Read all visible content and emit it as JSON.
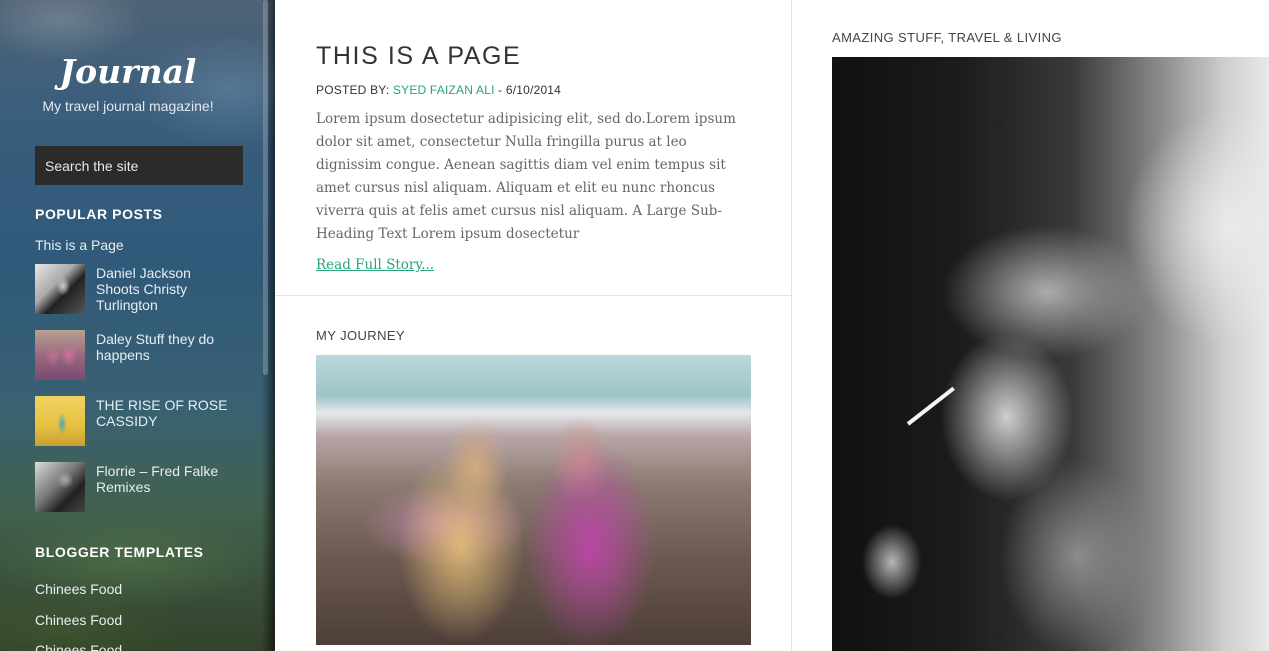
{
  "sidebar": {
    "site_title": "Journal",
    "tagline": "My travel journal magazine!",
    "search_placeholder": "Search the site",
    "popular_heading": "POPULAR POSTS",
    "popular_first_link": "This is a Page",
    "popular_posts": [
      {
        "title": "Daniel Jackson Shoots Christy Turlington"
      },
      {
        "title": "Daley Stuff they do happens"
      },
      {
        "title": "THE RISE OF ROSE CASSIDY"
      },
      {
        "title": "Florrie – Fred Falke Remixes"
      }
    ],
    "templates_heading": "BLOGGER TEMPLATES",
    "template_links": [
      "Chinees Food",
      "Chinees Food",
      "Chinees Food"
    ]
  },
  "post": {
    "title": "THIS IS A PAGE",
    "posted_by_label": "POSTED BY:",
    "author": "SYED FAIZAN ALI",
    "date_sep": " - ",
    "date": "6/10/2014",
    "excerpt": "Lorem ipsum dosectetur adipisicing elit, sed do.Lorem ipsum dolor sit amet, consectetur Nulla fringilla purus at leo dignissim congue. Aenean sagittis diam vel enim tempus sit amet cursus nisl aliquam. Aliquam et elit eu nunc rhoncus viverra quis at felis amet cursus nisl aliquam. A Large Sub-Heading Text Lorem ipsum dosectetur",
    "read_more": "Read Full Story...",
    "section_label": "MY JOURNEY"
  },
  "right": {
    "section_label": "AMAZING STUFF, TRAVEL & LIVING"
  },
  "colors": {
    "accent": "#27a47a",
    "search_bg": "#2b2b2b",
    "title_text": "#333333",
    "body_text": "#666666"
  }
}
